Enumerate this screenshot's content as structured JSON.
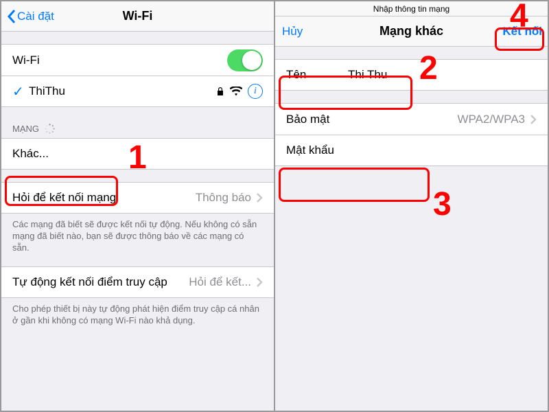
{
  "left": {
    "nav": {
      "back": "Cài đặt",
      "title": "Wi-Fi"
    },
    "wifi_toggle_label": "Wi-Fi",
    "wifi_toggle_on": true,
    "connected_network": "ThiThu",
    "section_networks": "MẠNG",
    "other_label": "Khác...",
    "ask_to_join": {
      "label": "Hỏi để kết nối mạng",
      "value": "Thông báo"
    },
    "ask_footer": "Các mạng đã biết sẽ được kết nối tự động. Nếu không có sẵn mạng đã biết nào, bạn sẽ được thông báo về các mạng có sẵn.",
    "auto_join": {
      "label": "Tự động kết nối điểm truy cập",
      "value": "Hỏi để kết..."
    },
    "auto_footer": "Cho phép thiết bị này tự động phát hiện điểm truy cập cá nhân ở gần khi không có mạng Wi-Fi nào khả dụng."
  },
  "right": {
    "subtitle": "Nhập thông tin mạng",
    "nav": {
      "cancel": "Hủy",
      "title": "Mạng khác",
      "connect": "Kết nối"
    },
    "name_label": "Tên",
    "name_value": "Thi Thu",
    "security": {
      "label": "Bảo mật",
      "value": "WPA2/WPA3"
    },
    "password_label": "Mật khẩu"
  },
  "annotations": {
    "n1": "1",
    "n2": "2",
    "n3": "3",
    "n4": "4"
  }
}
